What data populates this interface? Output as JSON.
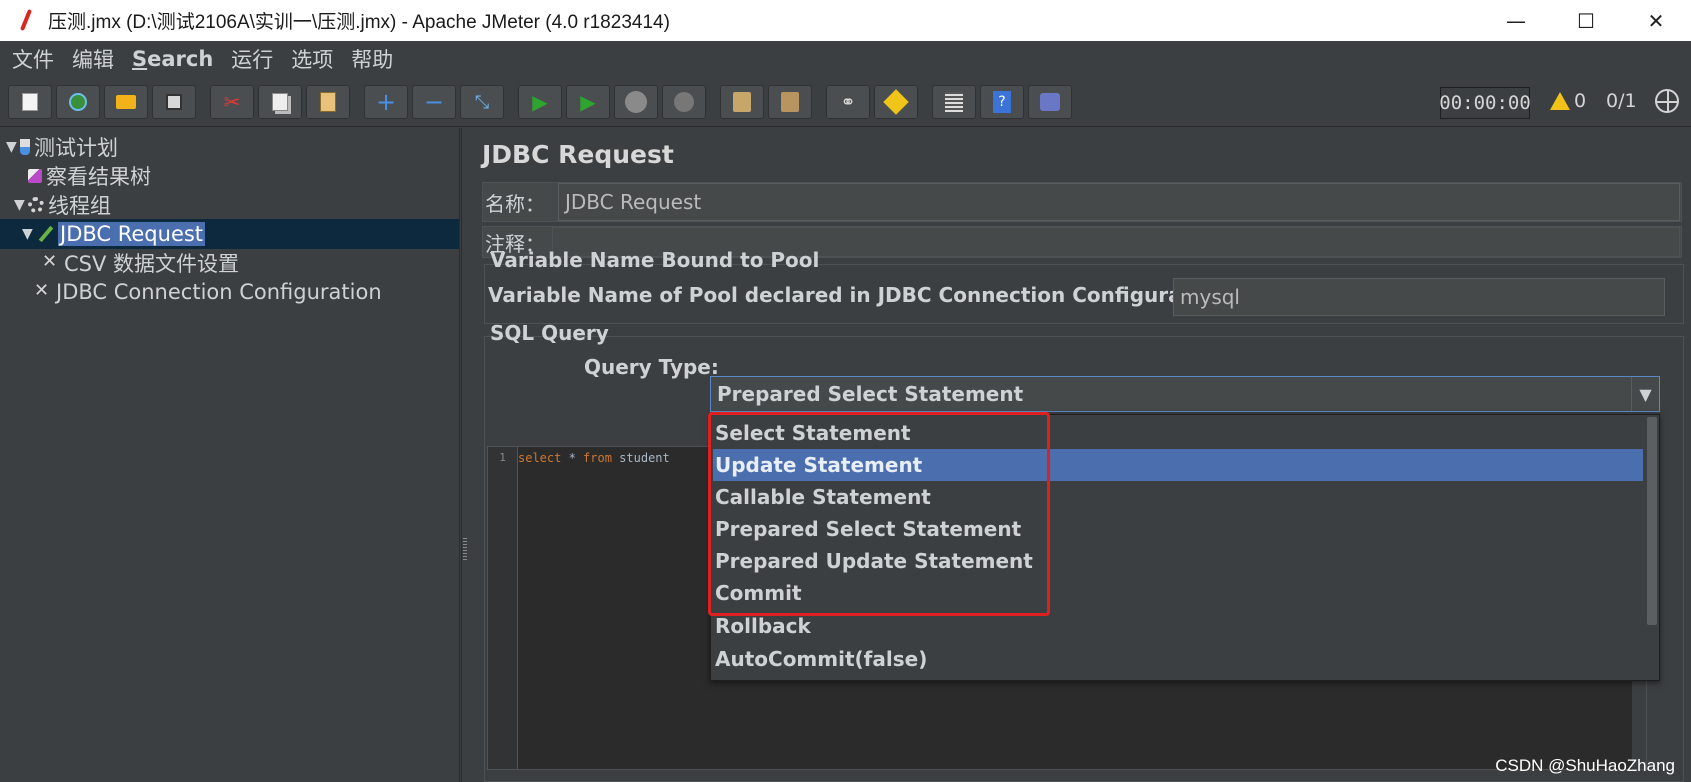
{
  "window": {
    "title": "压测.jmx (D:\\测试2106A\\实训一\\压测.jmx) - Apache JMeter (4.0 r1823414)",
    "minimize": "—",
    "maximize": "☐",
    "close": "✕"
  },
  "menu": [
    "文件",
    "编辑",
    "Search",
    "运行",
    "选项",
    "帮助"
  ],
  "toolbar": {
    "timer": "00:00:00",
    "warnings": "0",
    "threads": "0/1"
  },
  "tree": {
    "test_plan": "测试计划",
    "results_tree": "察看结果树",
    "thread_group": "线程组",
    "jdbc_request": "JDBC Request",
    "csv_config": "CSV 数据文件设置",
    "jdbc_connection": "JDBC Connection Configuration"
  },
  "panel": {
    "title": "JDBC Request",
    "name_label": "名称：",
    "name_value": "JDBC Request",
    "comment_label": "注释：",
    "comment_value": "",
    "pool_group_title": "Variable Name Bound to Pool",
    "pool_label": "Variable Name of Pool declared in JDBC Connection Configuration:",
    "pool_value": "mysql",
    "sql_group_title": "SQL Query",
    "query_type_label": "Query Type:",
    "query_type_value": "Prepared Select Statement",
    "query_type_arrow": "▼",
    "editor_line": "1",
    "editor_code": {
      "kw1": "select",
      "mid": " * ",
      "kw2": "from",
      "rest": " student"
    }
  },
  "dropdown": {
    "options": [
      "Select Statement",
      "Update Statement",
      "Callable Statement",
      "Prepared Select Statement",
      "Prepared Update Statement",
      "Commit",
      "Rollback",
      "AutoCommit(false)"
    ],
    "highlighted_index": 1
  },
  "watermark": "CSDN @ShuHaoZhang"
}
